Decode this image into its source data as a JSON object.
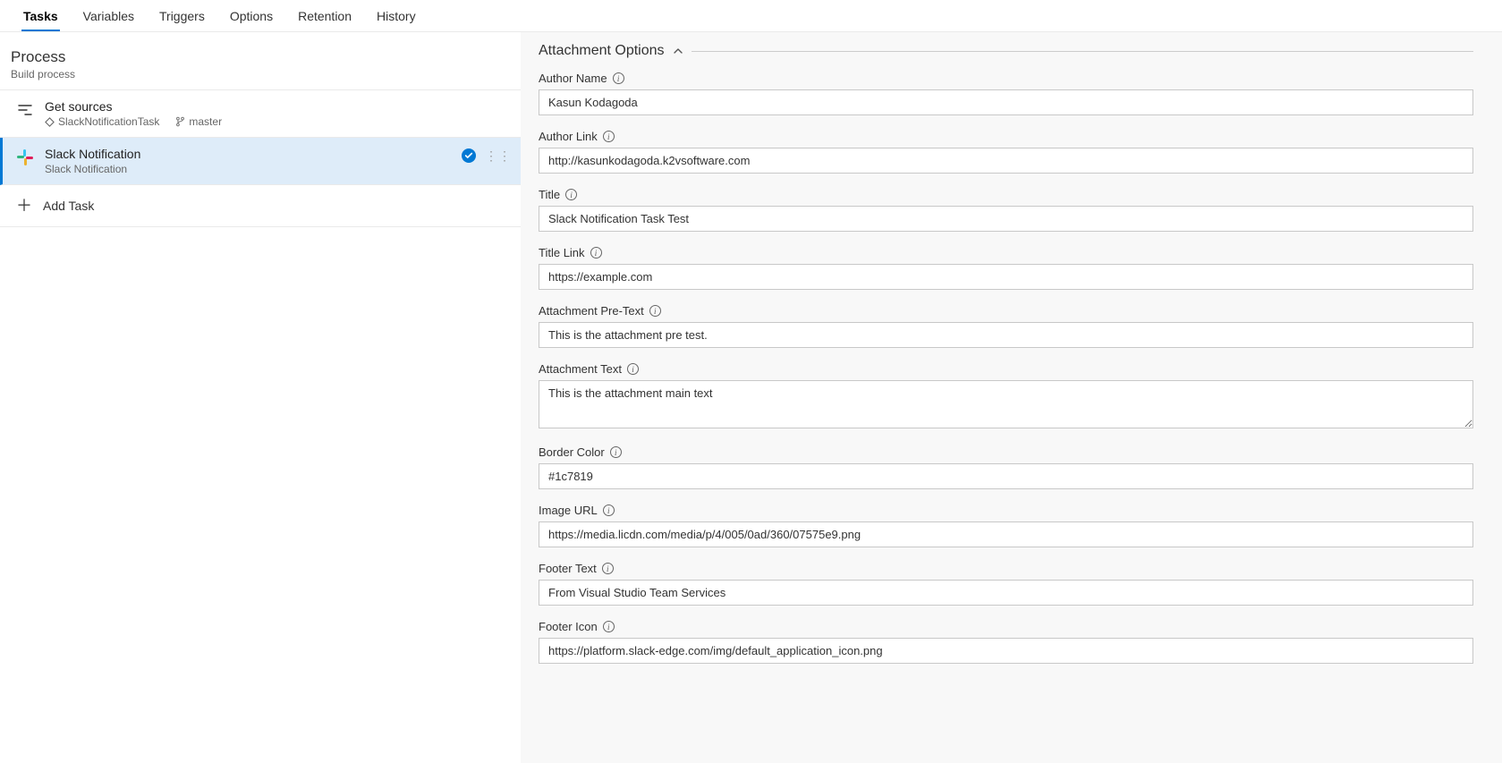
{
  "tabs": {
    "items": [
      "Tasks",
      "Variables",
      "Triggers",
      "Options",
      "Retention",
      "History"
    ],
    "active": 0
  },
  "process": {
    "title": "Process",
    "subtitle": "Build process"
  },
  "leftRows": {
    "getSources": {
      "title": "Get sources",
      "repo": "SlackNotificationTask",
      "branch": "master"
    },
    "slack": {
      "title": "Slack Notification",
      "subtitle": "Slack Notification"
    },
    "addTask": "Add Task"
  },
  "form": {
    "sectionTitle": "Attachment Options",
    "authorName": {
      "label": "Author Name",
      "value": "Kasun Kodagoda"
    },
    "authorLink": {
      "label": "Author Link",
      "value": "http://kasunkodagoda.k2vsoftware.com"
    },
    "title": {
      "label": "Title",
      "value": "Slack Notification Task Test"
    },
    "titleLink": {
      "label": "Title Link",
      "value": "https://example.com"
    },
    "preText": {
      "label": "Attachment Pre-Text",
      "value": "This is the attachment pre test."
    },
    "attText": {
      "label": "Attachment Text",
      "value": "This is the attachment main text"
    },
    "borderColor": {
      "label": "Border Color",
      "value": "#1c7819"
    },
    "imageUrl": {
      "label": "Image URL",
      "value": "https://media.licdn.com/media/p/4/005/0ad/360/07575e9.png"
    },
    "footerText": {
      "label": "Footer Text",
      "value": "From Visual Studio Team Services"
    },
    "footerIcon": {
      "label": "Footer Icon",
      "value": "https://platform.slack-edge.com/img/default_application_icon.png"
    }
  }
}
